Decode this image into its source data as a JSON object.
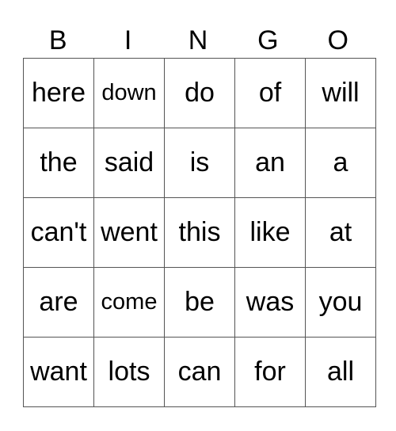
{
  "header": [
    "B",
    "I",
    "N",
    "G",
    "O"
  ],
  "rows": [
    [
      "here",
      "down",
      "do",
      "of",
      "will"
    ],
    [
      "the",
      "said",
      "is",
      "an",
      "a"
    ],
    [
      "can't",
      "went",
      "this",
      "like",
      "at"
    ],
    [
      "are",
      "come",
      "be",
      "was",
      "you"
    ],
    [
      "want",
      "lots",
      "can",
      "for",
      "all"
    ]
  ]
}
